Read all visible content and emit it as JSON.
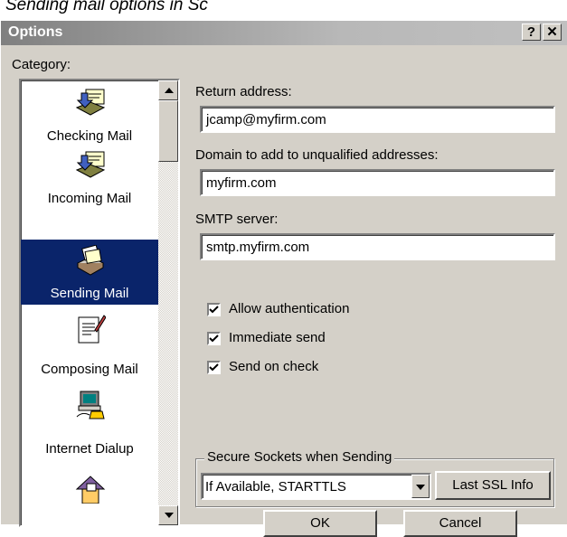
{
  "caption": "Sending mail options in Sc",
  "window": {
    "title": "Options",
    "help_label": "?",
    "close_label": "✕"
  },
  "category": {
    "label": "Category:",
    "items": [
      {
        "label": "Checking Mail",
        "icon": "mailbox-download-icon",
        "selected": false
      },
      {
        "label": "Incoming Mail",
        "icon": "mailbox-download-icon",
        "selected": false
      },
      {
        "label": "Sending Mail",
        "icon": "mail-send-icon",
        "selected": true
      },
      {
        "label": "Composing Mail",
        "icon": "document-pencil-icon",
        "selected": false
      },
      {
        "label": "Internet Dialup",
        "icon": "computer-phone-icon",
        "selected": false
      },
      {
        "label": "",
        "icon": "house-mail-icon",
        "selected": false
      }
    ]
  },
  "fields": {
    "return_address": {
      "label": "Return address:",
      "value": "jcamp@myfirm.com"
    },
    "domain": {
      "label": "Domain to add to unqualified addresses:",
      "value": "myfirm.com"
    },
    "smtp": {
      "label": "SMTP server:",
      "value": "smtp.myfirm.com"
    }
  },
  "checkboxes": [
    {
      "label": "Allow authentication",
      "checked": true
    },
    {
      "label": "Immediate send",
      "checked": true
    },
    {
      "label": "Send on check",
      "checked": true
    }
  ],
  "ssl": {
    "group_label": "Secure Sockets when Sending",
    "selected": "If Available, STARTTLS",
    "info_button": "Last SSL Info"
  },
  "buttons": {
    "ok": "OK",
    "cancel": "Cancel"
  },
  "colors": {
    "selection": "#0a246a",
    "face": "#d4d0c8"
  }
}
